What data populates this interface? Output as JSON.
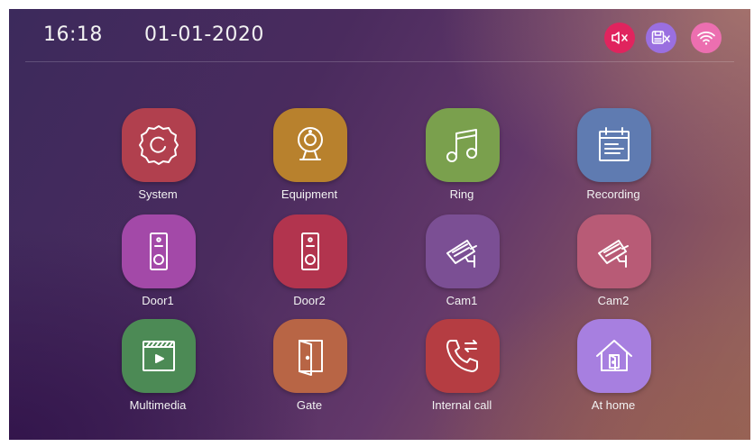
{
  "header": {
    "time": "16:18",
    "date": "01-01-2020"
  },
  "status_icons": [
    {
      "name": "mute-icon",
      "color": "#e0245e"
    },
    {
      "name": "sd-card-missing-icon",
      "color": "#9a6fe0"
    },
    {
      "name": "wifi-icon",
      "color": "#ec6fb0"
    }
  ],
  "tiles": [
    {
      "label": "System",
      "icon": "gear-icon",
      "color": "#b1404e"
    },
    {
      "label": "Equipment",
      "icon": "camera-icon",
      "color": "#b8812d"
    },
    {
      "label": "Ring",
      "icon": "music-note-icon",
      "color": "#7aa04d"
    },
    {
      "label": "Recording",
      "icon": "calendar-icon",
      "color": "#5f7bb1"
    },
    {
      "label": "Door1",
      "icon": "doorbell-icon",
      "color": "#a349a8"
    },
    {
      "label": "Door2",
      "icon": "doorbell-icon",
      "color": "#b2344e"
    },
    {
      "label": "Cam1",
      "icon": "cctv-icon",
      "color": "#7b4f94"
    },
    {
      "label": "Cam2",
      "icon": "cctv-icon",
      "color": "#b85b76"
    },
    {
      "label": "Multimedia",
      "icon": "video-player-icon",
      "color": "#4c8a55"
    },
    {
      "label": "Gate",
      "icon": "door-icon",
      "color": "#b86545"
    },
    {
      "label": "Internal call",
      "icon": "phone-call-icon",
      "color": "#b53d42"
    },
    {
      "label": "At home",
      "icon": "home-icon",
      "color": "#a77fe0"
    }
  ]
}
